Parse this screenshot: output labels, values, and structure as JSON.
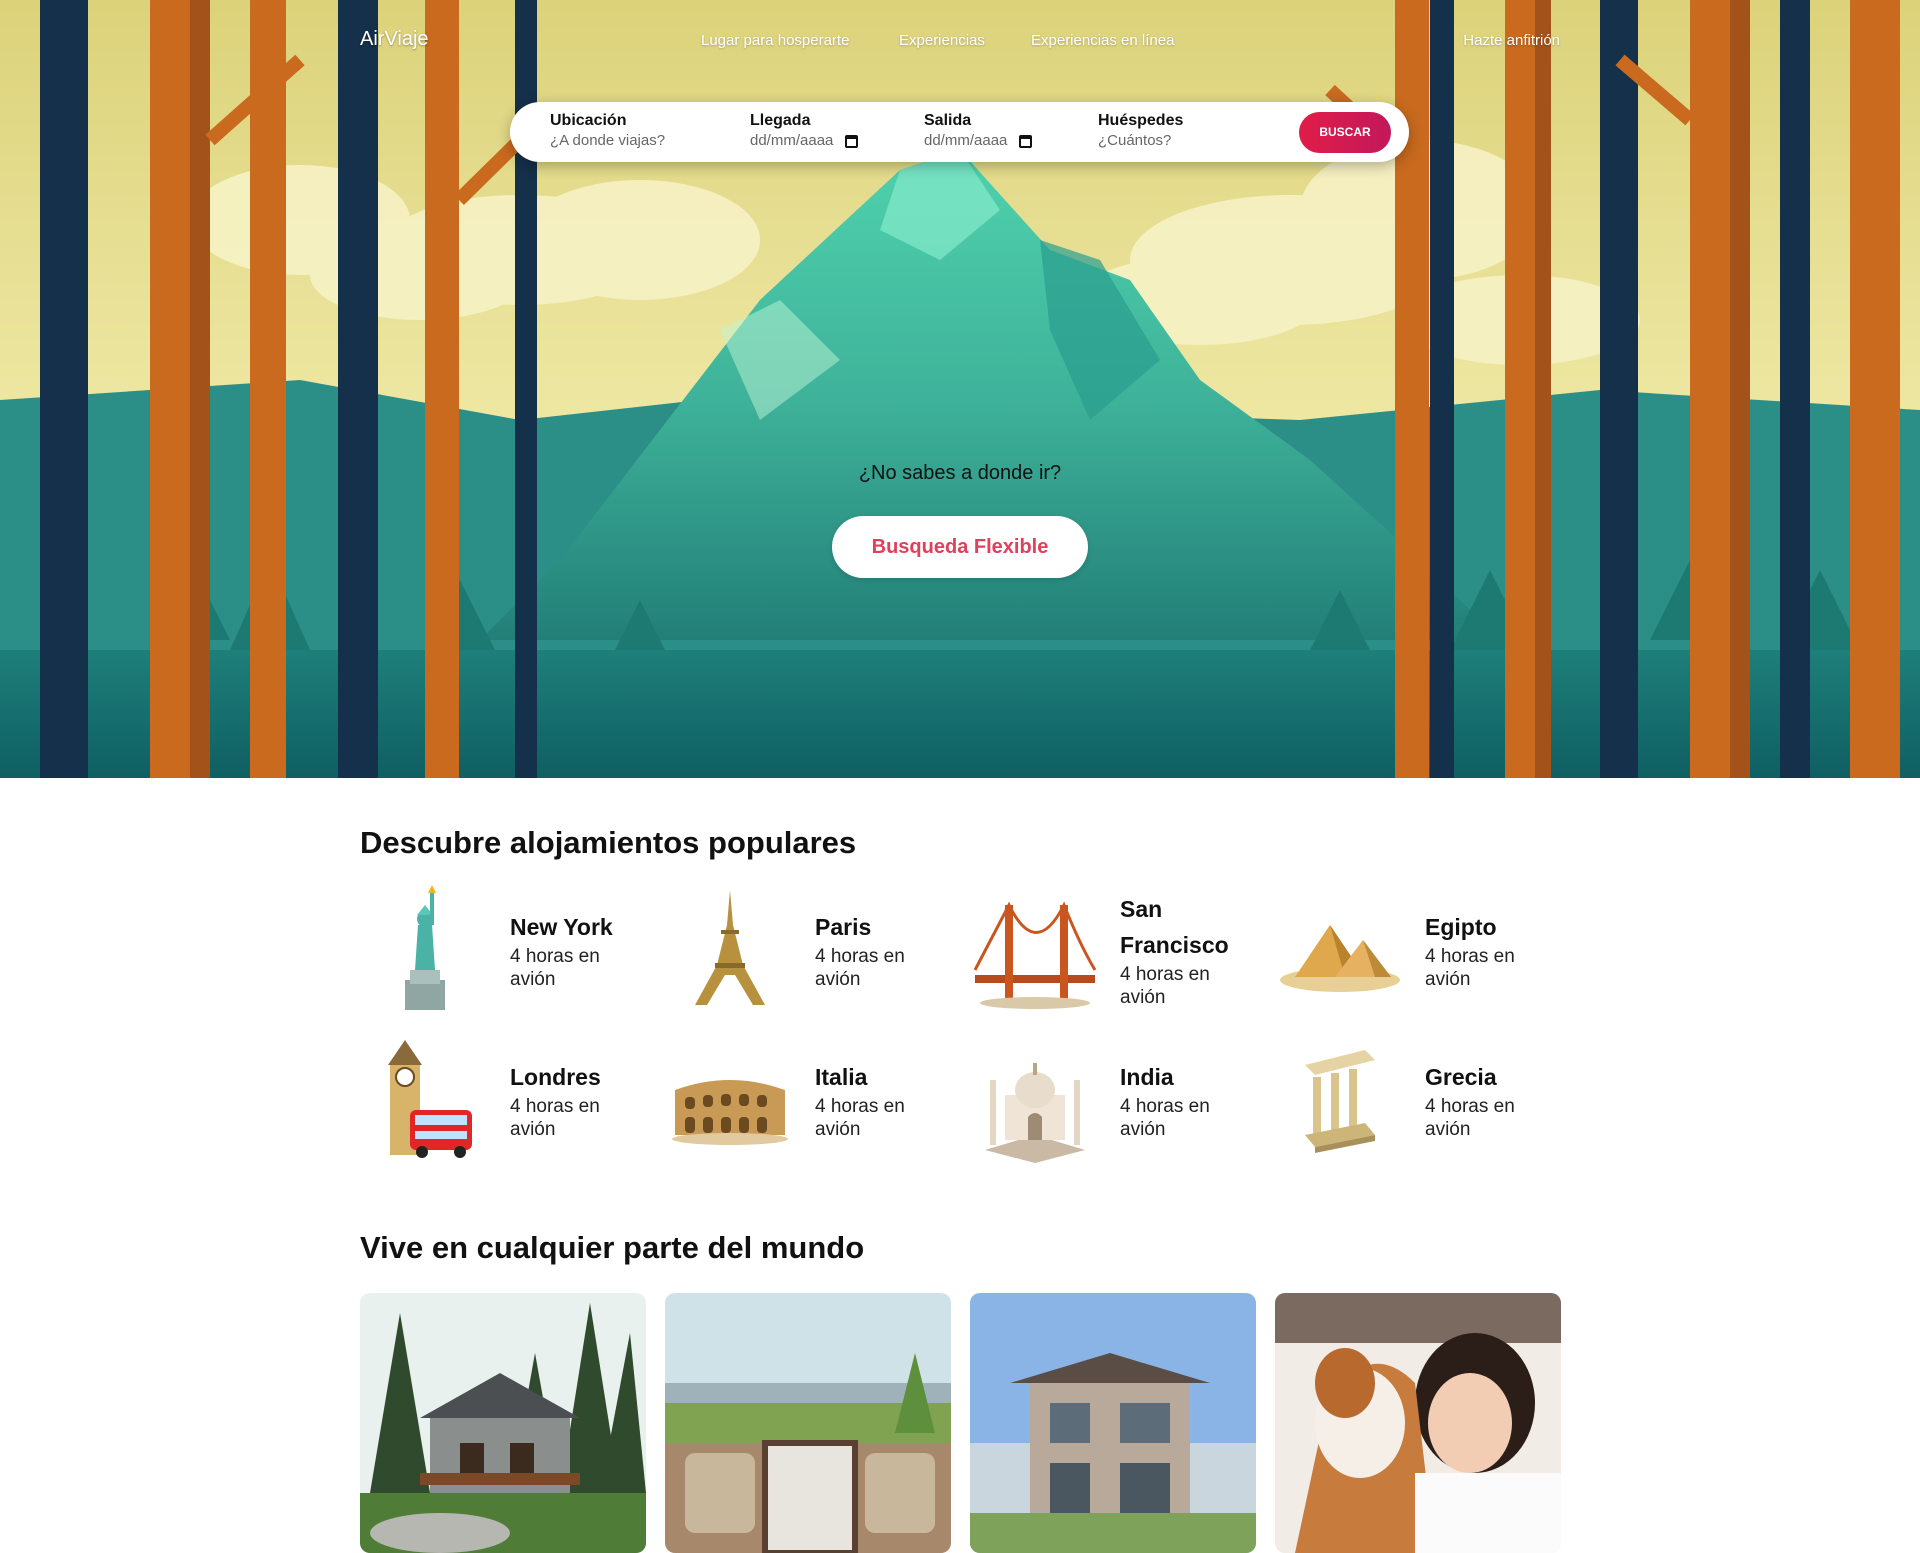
{
  "nav": {
    "brand": "AirViaje",
    "links": [
      "Lugar para hosperarte",
      "Experiencias",
      "Experiencias en línea"
    ],
    "host": "Hazte anfitrión"
  },
  "search": {
    "location": {
      "label": "Ubicación",
      "placeholder": "¿A donde viajas?"
    },
    "arrival": {
      "label": "Llegada",
      "placeholder": "dd/mm/aaaa"
    },
    "departure": {
      "label": "Salida",
      "placeholder": "dd/mm/aaaa"
    },
    "guests": {
      "label": "Huéspedes",
      "placeholder": "¿Cuántos?"
    },
    "button": "BUSCAR"
  },
  "hero": {
    "question": "¿No sabes a donde ir?",
    "flex_button": "Busqueda Flexible"
  },
  "popular": {
    "title": "Descubre alojamientos populares",
    "items": [
      {
        "name": "New York",
        "time": "4 horas en avión",
        "icon": "statue-of-liberty-icon"
      },
      {
        "name": "Paris",
        "time": "4 horas en avión",
        "icon": "eiffel-tower-icon"
      },
      {
        "name": "San Francisco",
        "time": "4 horas en avión",
        "icon": "golden-gate-bridge-icon"
      },
      {
        "name": "Egipto",
        "time": "4 horas en avión",
        "icon": "pyramids-icon"
      },
      {
        "name": "Londres",
        "time": "4 horas en avión",
        "icon": "big-ben-icon"
      },
      {
        "name": "Italia",
        "time": "4 horas en avión",
        "icon": "colosseum-icon"
      },
      {
        "name": "India",
        "time": "4 horas en avión",
        "icon": "taj-mahal-icon"
      },
      {
        "name": "Grecia",
        "time": "4 horas en avión",
        "icon": "greek-temple-icon"
      }
    ]
  },
  "live": {
    "title": "Vive en cualquier parte del mundo",
    "cards": [
      "forest-cabin-photo",
      "rooftop-terrace-photo",
      "modern-house-photo",
      "woman-with-dog-photo"
    ]
  },
  "colors": {
    "accent": "#e11d48",
    "flex_text": "#e0405a",
    "sky": "#e7dd8a",
    "mountain": "#2e9a8a",
    "trunk": "#c96a1e",
    "dark_trunk": "#16304a"
  }
}
